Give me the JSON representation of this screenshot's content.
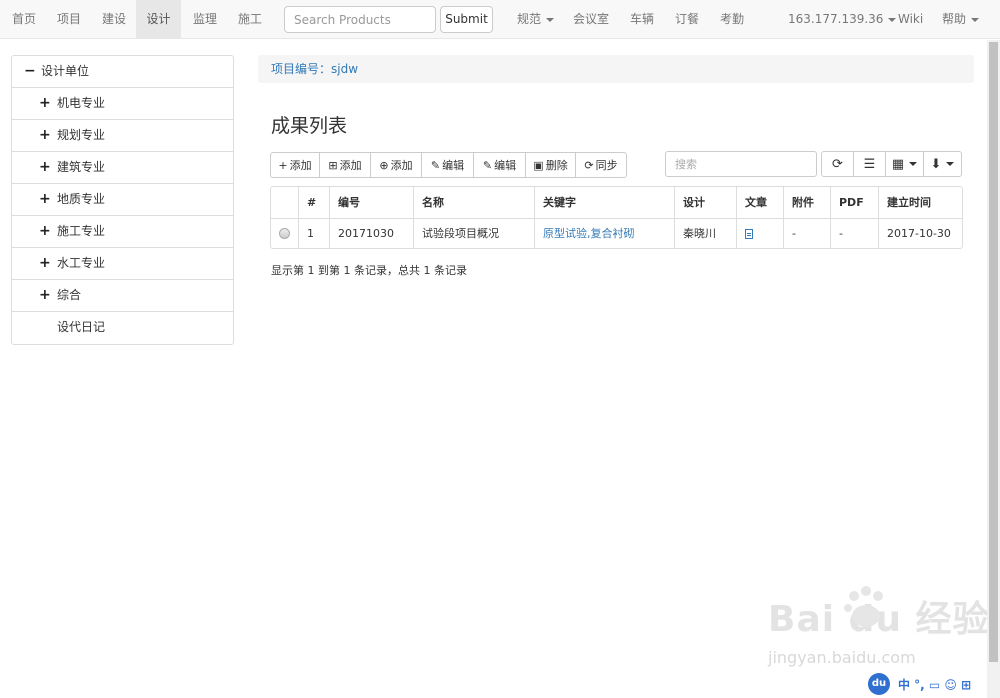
{
  "nav": {
    "items": [
      {
        "label": "首页"
      },
      {
        "label": "项目"
      },
      {
        "label": "建设"
      },
      {
        "label": "设计"
      },
      {
        "label": "监理"
      },
      {
        "label": "施工"
      }
    ],
    "search_placeholder": "Search Products",
    "submit_label": "Submit",
    "right_items": [
      {
        "label": "规范"
      },
      {
        "label": "会议室"
      },
      {
        "label": "车辆"
      },
      {
        "label": "订餐"
      },
      {
        "label": "考勤"
      },
      {
        "label": "163.177.139.36"
      },
      {
        "label": "Wiki"
      },
      {
        "label": "帮助"
      }
    ]
  },
  "tree": {
    "root": {
      "label": "设计单位",
      "expander": "−"
    },
    "items": [
      {
        "label": "机电专业",
        "expander": "+"
      },
      {
        "label": "规划专业",
        "expander": "+"
      },
      {
        "label": "建筑专业",
        "expander": "+"
      },
      {
        "label": "地质专业",
        "expander": "+"
      },
      {
        "label": "施工专业",
        "expander": "+"
      },
      {
        "label": "水工专业",
        "expander": "+"
      },
      {
        "label": "综合",
        "expander": "+"
      },
      {
        "label": "设代日记",
        "expander": ""
      }
    ]
  },
  "breadcrumb": "项目编号：sjdw",
  "page_title": "成果列表",
  "toolbar": {
    "buttons": [
      {
        "icon": "plus-icon",
        "glyph": "+",
        "label": "添加"
      },
      {
        "icon": "plus-square-icon",
        "glyph": "⊞",
        "label": "添加"
      },
      {
        "icon": "plus-square-filled-icon",
        "glyph": "⊕",
        "label": "添加"
      },
      {
        "icon": "edit-icon",
        "glyph": "✎",
        "label": "编辑"
      },
      {
        "icon": "edit-icon",
        "glyph": "✎",
        "label": "编辑"
      },
      {
        "icon": "trash-icon",
        "glyph": "▣",
        "label": "删除"
      },
      {
        "icon": "sync-icon",
        "glyph": "⟳",
        "label": "同步"
      }
    ],
    "search_placeholder": "搜索",
    "right_buttons": [
      {
        "icon": "refresh-icon",
        "glyph": "⟳"
      },
      {
        "icon": "list-icon",
        "glyph": "☰"
      },
      {
        "icon": "columns-icon",
        "glyph": "▦"
      },
      {
        "icon": "export-icon",
        "glyph": "⬇"
      }
    ]
  },
  "table": {
    "headers": [
      "",
      "#",
      "编号",
      "名称",
      "关键字",
      "设计",
      "文章",
      "附件",
      "PDF",
      "建立时间"
    ],
    "rows": [
      {
        "num": "1",
        "code": "20171030",
        "name": "试验段项目概况",
        "keywords": "原型试验,复合衬砌",
        "designer": "秦晓川",
        "attachment": "-",
        "pdf": "-",
        "created": "2017-10-30"
      }
    ]
  },
  "pagination_info": "显示第 1 到第 1 条记录，总共 1 条记录",
  "watermark": {
    "main": "Bai du 经验",
    "sub": "jingyan.baidu.com"
  },
  "ime": {
    "du": "du",
    "text": "中 °, ▭ ☺ ⊞"
  },
  "colors": {
    "link": "#337ab7",
    "nav_bg": "#f8f8f8",
    "active_nav_bg": "#e7e7e7"
  }
}
